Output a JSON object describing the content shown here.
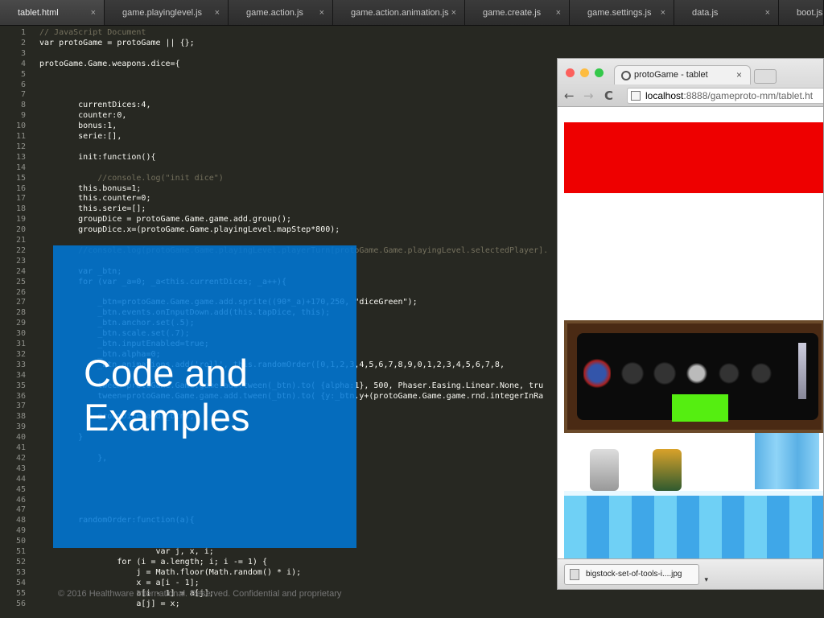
{
  "tabs": [
    {
      "label": "tablet.html"
    },
    {
      "label": "game.playinglevel.js"
    },
    {
      "label": "game.action.js"
    },
    {
      "label": "game.action.animation.js"
    },
    {
      "label": "game.create.js"
    },
    {
      "label": "game.settings.js"
    },
    {
      "label": "data.js"
    },
    {
      "label": "boot.js"
    }
  ],
  "tab_close_glyph": "×",
  "code_lines": [
    {
      "n": "1",
      "t": "// JavaScript Document"
    },
    {
      "n": "2",
      "t": "var protoGame = protoGame || {};"
    },
    {
      "n": "3",
      "t": ""
    },
    {
      "n": "4",
      "t": "protoGame.Game.weapons.dice={"
    },
    {
      "n": "5",
      "t": ""
    },
    {
      "n": "6",
      "t": ""
    },
    {
      "n": "7",
      "t": ""
    },
    {
      "n": "8",
      "t": "        currentDices:4,"
    },
    {
      "n": "9",
      "t": "        counter:0,"
    },
    {
      "n": "10",
      "t": "        bonus:1,"
    },
    {
      "n": "11",
      "t": "        serie:[],"
    },
    {
      "n": "12",
      "t": ""
    },
    {
      "n": "13",
      "t": "        init:function(){"
    },
    {
      "n": "14",
      "t": ""
    },
    {
      "n": "15",
      "t": "            //console.log(\"init dice\")"
    },
    {
      "n": "16",
      "t": "        this.bonus=1;"
    },
    {
      "n": "17",
      "t": "        this.counter=0;"
    },
    {
      "n": "18",
      "t": "        this.serie=[];"
    },
    {
      "n": "19",
      "t": "        groupDice = protoGame.Game.game.add.group();"
    },
    {
      "n": "20",
      "t": "        groupDice.x=(protoGame.Game.playingLevel.mapStep*800);"
    },
    {
      "n": "21",
      "t": ""
    },
    {
      "n": "22",
      "t": "        //console.log(protoGame.Game.playingLevel.playerTurn[protoGame.Game.playingLevel.selectedPlayer]."
    },
    {
      "n": "23",
      "t": ""
    },
    {
      "n": "24",
      "t": "        var _btn;"
    },
    {
      "n": "25",
      "t": "        for (var _a=0; _a<this.currentDices; _a++){"
    },
    {
      "n": "26",
      "t": ""
    },
    {
      "n": "27",
      "t": "            _btn=protoGame.Game.game.add.sprite((90*_a)+170,250, \"diceGreen\");"
    },
    {
      "n": "28",
      "t": "            _btn.events.onInputDown.add(this.tapDice, this);"
    },
    {
      "n": "29",
      "t": "            _btn.anchor.set(.5);"
    },
    {
      "n": "30",
      "t": "            _btn.scale.set(.7);"
    },
    {
      "n": "31",
      "t": "            _btn.inputEnabled=true;"
    },
    {
      "n": "32",
      "t": "            _btn.alpha=0;"
    },
    {
      "n": "33",
      "t": "            _btn.animations.add('roll', this.randomOrder([0,1,2,3,4,5,6,7,8,9,0,1,2,3,4,5,6,7,8,"
    },
    {
      "n": "34",
      "t": ""
    },
    {
      "n": "35",
      "t": "            tween=protoGame.Game.game.add.tween(_btn).to( {alpha:1}, 500, Phaser.Easing.Linear.None, tru"
    },
    {
      "n": "36",
      "t": "            tween=protoGame.Game.game.add.tween(_btn).to( {y:_btn.y+(protoGame.Game.game.rnd.integerInRa"
    },
    {
      "n": "37",
      "t": ""
    },
    {
      "n": "38",
      "t": "            groupDice.add(_btn);"
    },
    {
      "n": "39",
      "t": ""
    },
    {
      "n": "40",
      "t": "        }"
    },
    {
      "n": "41",
      "t": ""
    },
    {
      "n": "42",
      "t": "            },"
    },
    {
      "n": "43",
      "t": ""
    },
    {
      "n": "44",
      "t": ""
    },
    {
      "n": "45",
      "t": ""
    },
    {
      "n": "46",
      "t": ""
    },
    {
      "n": "47",
      "t": ""
    },
    {
      "n": "48",
      "t": "        randomOrder:function(a){"
    },
    {
      "n": "49",
      "t": ""
    },
    {
      "n": "50",
      "t": ""
    },
    {
      "n": "51",
      "t": "                        var j, x, i;"
    },
    {
      "n": "52",
      "t": "                for (i = a.length; i; i -= 1) {"
    },
    {
      "n": "53",
      "t": "                    j = Math.floor(Math.random() * i);"
    },
    {
      "n": "54",
      "t": "                    x = a[i - 1];"
    },
    {
      "n": "55",
      "t": "                    a[i - 1] = a[j];"
    },
    {
      "n": "56",
      "t": "                    a[j] = x;"
    }
  ],
  "overlay": {
    "title": "Code and\nExamples",
    "color": "#0078d7"
  },
  "copyright": "© 2016 Healthware International. Reserved. Confidential and proprietary",
  "browser": {
    "tab_title": "protoGame - tablet",
    "tab_close": "×",
    "url_host": "localhost",
    "url_rest": ":8888/gameproto-mm/tablet.ht",
    "back_icon": "←",
    "forward_icon": "→",
    "reload_icon": "C",
    "download_file": "bigstock-set-of-tools-i....jpg",
    "download_arrow": "▾"
  },
  "game": {
    "bar_color": "#ee0000",
    "hud_button_color": "#55ee11"
  }
}
